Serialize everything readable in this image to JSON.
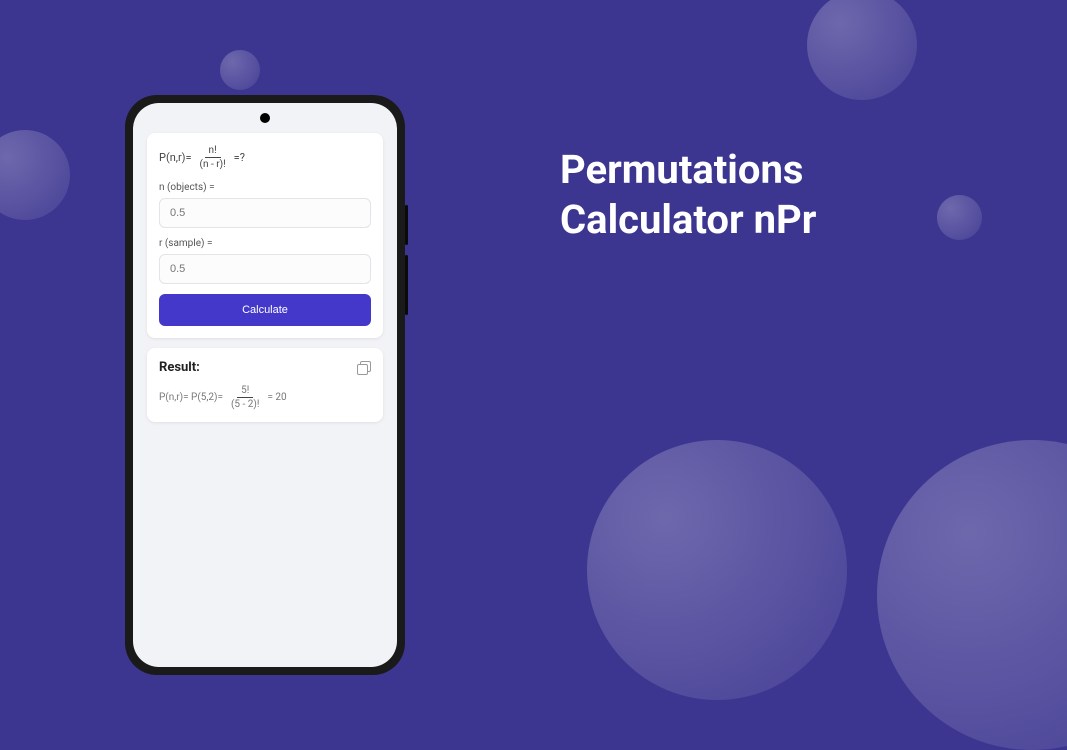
{
  "title_line1": "Permutations",
  "title_line2": "Calculator nPr",
  "app": {
    "formula": {
      "prefix": "P(n,r)=",
      "numerator": "n!",
      "denominator": "(n - r)!",
      "suffix": "=?"
    },
    "fields": {
      "n_label": "n (objects) =",
      "n_placeholder": "0.5",
      "r_label": "r (sample) =",
      "r_placeholder": "0.5"
    },
    "calculate_label": "Calculate",
    "result": {
      "title": "Result:",
      "prefix": "P(n,r)= P(5,2)=",
      "numerator": "5!",
      "denominator": "(5 - 2)!",
      "value": "= 20"
    }
  }
}
